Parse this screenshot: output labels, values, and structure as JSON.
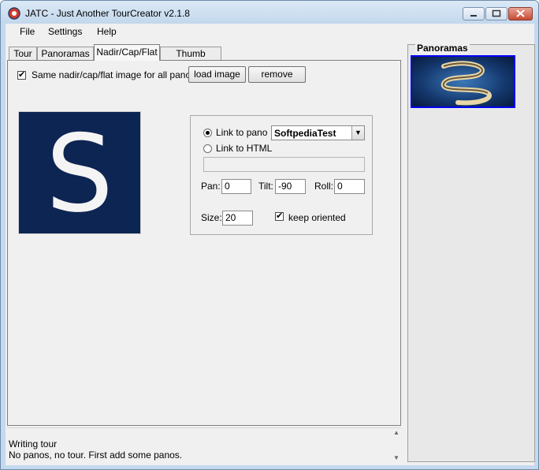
{
  "window": {
    "title": "JATC - Just Another TourCreator v2.1.8"
  },
  "menu": [
    "File",
    "Settings",
    "Help"
  ],
  "tabs": [
    "Tour",
    "Panoramas",
    "Nadir/Cap/Flat",
    "Thumb gallery"
  ],
  "active_tab": "Nadir/Cap/Flat",
  "nadir": {
    "same_image_label": "Same nadir/cap/flat image for all panos",
    "same_image_checked": true,
    "load_button": "load image",
    "remove_button": "remove",
    "preview_letter": "S",
    "link_to_pano_label": "Link to pano",
    "link_to_pano_selected": true,
    "pano_select_value": "SoftpediaTest",
    "link_to_html_label": "Link to HTML",
    "html_value": "",
    "pan_label": "Pan:",
    "pan_value": "0",
    "tilt_label": "Tilt:",
    "tilt_value": "-90",
    "roll_label": "Roll:",
    "roll_value": "0",
    "size_label": "Size:",
    "size_value": "20",
    "keep_oriented_label": "keep oriented",
    "keep_oriented_checked": true
  },
  "status": {
    "line1": "Writing tour",
    "line2": "No panos, no tour. First add some panos."
  },
  "panoramas_panel": {
    "title": "Panoramas"
  },
  "icons": {
    "check": "✔",
    "dropdown": "▼",
    "scroll_up": "▲",
    "scroll_down": "▼"
  },
  "colors": {
    "preview_bg": "#0d2553",
    "selection_border": "#0000ff"
  }
}
